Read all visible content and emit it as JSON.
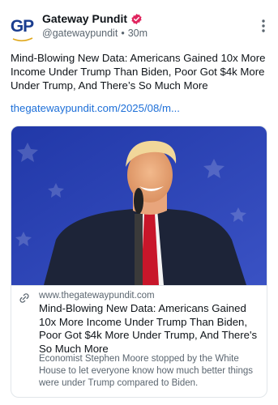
{
  "author": {
    "display_name": "Gateway Pundit",
    "handle": "@gatewaypundit",
    "separator": "•",
    "time_ago": "30m",
    "avatar_text": "GP",
    "verified_color": "#e0245e"
  },
  "post": {
    "text": "Mind-Blowing New Data: Americans Gained 10x More Income Under Trump Than Biden, Poor Got $4k More Under Trump, And There’s So Much More",
    "link_text": "thegatewaypundit.com/2025/08/m..."
  },
  "card": {
    "domain": "www.thegatewaypundit.com",
    "title": "Mind-Blowing New Data: Americans Gained 10x More Income Under Trump Than Biden, Poor Got $4k More Under Trump, And There's So Much More",
    "description": "Economist Stephen Moore stopped by the White House to let everyone know how much better things were under Trump compared to Biden.",
    "link_icon": "link-icon"
  },
  "colors": {
    "link": "#1d6fd8",
    "muted": "#5b6670",
    "image_bg": "#2a3fb0"
  }
}
